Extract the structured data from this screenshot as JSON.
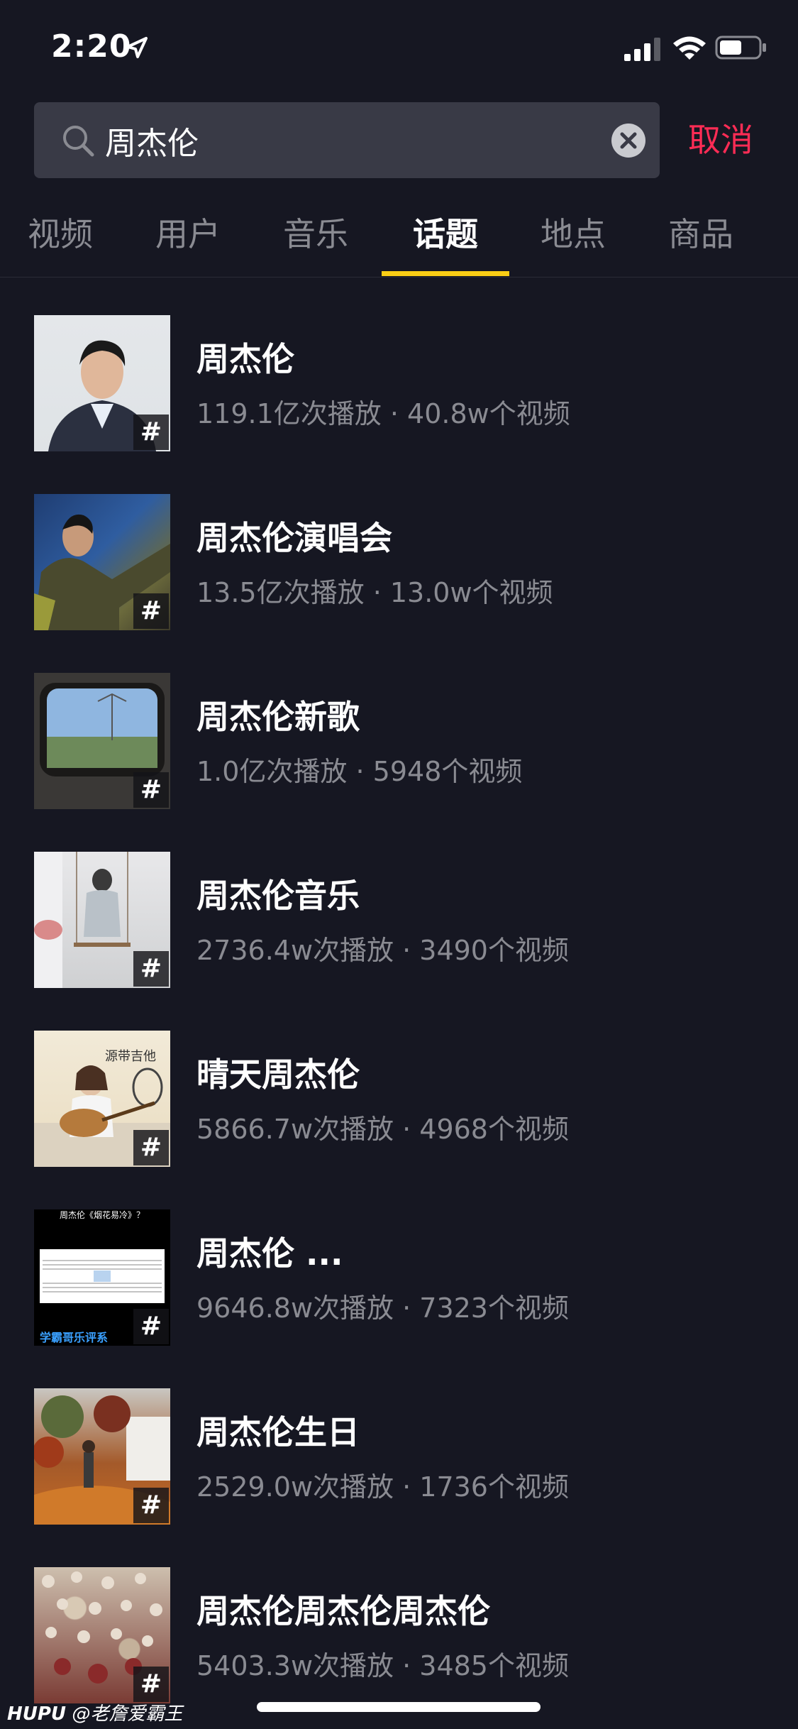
{
  "status_bar": {
    "time": "2:20"
  },
  "search": {
    "query": "周杰伦",
    "cancel_label": "取消"
  },
  "tabs": [
    {
      "label": "视频"
    },
    {
      "label": "用户"
    },
    {
      "label": "音乐"
    },
    {
      "label": "话题",
      "active": true
    },
    {
      "label": "地点"
    },
    {
      "label": "商品"
    }
  ],
  "topics": [
    {
      "title": "周杰伦",
      "stats": "119.1亿次播放 · 40.8w个视频"
    },
    {
      "title": "周杰伦演唱会",
      "stats": "13.5亿次播放 · 13.0w个视频"
    },
    {
      "title": "周杰伦新歌",
      "stats": "1.0亿次播放 · 5948个视频"
    },
    {
      "title": "周杰伦音乐",
      "stats": "2736.4w次播放 · 3490个视频"
    },
    {
      "title": "晴天周杰伦",
      "stats": "5866.7w次播放 · 4968个视频"
    },
    {
      "title": "周杰伦 ...",
      "stats": "9646.8w次播放 · 7323个视频"
    },
    {
      "title": "周杰伦生日",
      "stats": "2529.0w次播放 · 1736个视频"
    },
    {
      "title": "周杰伦周杰伦周杰伦",
      "stats": "5403.3w次播放 · 3485个视频"
    }
  ],
  "hash_symbol": "#",
  "thumb_texts": {
    "t6_top": "周杰伦《烟花易冷》？",
    "t6_bottom": "学霸哥乐评系",
    "t5_sign": "源带吉他"
  },
  "watermark": {
    "brand": "HUPU",
    "user": "@老詹爱霸王"
  },
  "colors": {
    "background": "#161722",
    "accent": "#fe2c55",
    "tab_indicator": "#face15",
    "muted": "#8a8b92"
  },
  "icons": [
    "location-arrow-icon",
    "signal-icon",
    "wifi-icon",
    "battery-icon",
    "search-icon",
    "clear-icon",
    "hashtag-icon"
  ]
}
